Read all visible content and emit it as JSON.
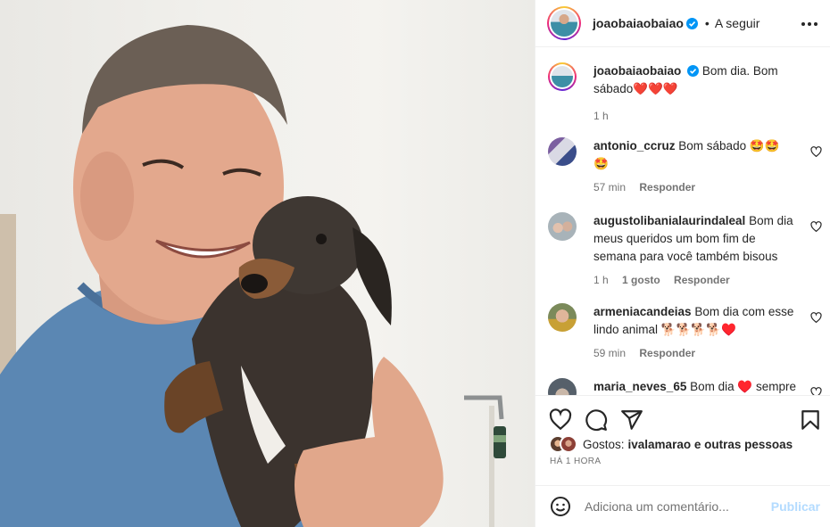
{
  "post": {
    "username": "joaobaiaobaiao",
    "follow_label": "A seguir",
    "separator": "•",
    "photo_description_icon": "photo"
  },
  "caption": {
    "username": "joaobaiaobaiao",
    "text": "Bom dia. Bom sábado",
    "emoji": "❤️❤️❤️",
    "time": "1 h"
  },
  "comments": [
    {
      "username": "antonio_ccruz",
      "text": "Bom sábado 🤩🤩",
      "text2": "🤩",
      "time": "57 min",
      "likes": "",
      "reply": "Responder"
    },
    {
      "username": "augustolibanialaurindaleal",
      "text": "Bom dia meus queridos um bom fim de semana para você também bisous",
      "time": "1 h",
      "likes": "1 gosto",
      "reply": "Responder"
    },
    {
      "username": "armeniacandeias",
      "text": "Bom dia com esse lindo animal 🐕🐕🐕🐕♥️",
      "time": "59 min",
      "likes": "",
      "reply": "Responder"
    },
    {
      "username": "maria_neves_65",
      "text": "Bom dia ♥️ sempre",
      "time": "",
      "likes": "",
      "reply": ""
    }
  ],
  "likes": {
    "label": "Gostos:",
    "text": "ivalamarao e outras pessoas"
  },
  "timestamp": "HÁ 1 HORA",
  "comment_box": {
    "placeholder": "Adiciona um comentário...",
    "publish_label": "Publicar"
  },
  "colors": {
    "verified": "#0095f6",
    "heart": "#ed4956",
    "publish_disabled": "#b3dbff",
    "meta": "#737373"
  }
}
